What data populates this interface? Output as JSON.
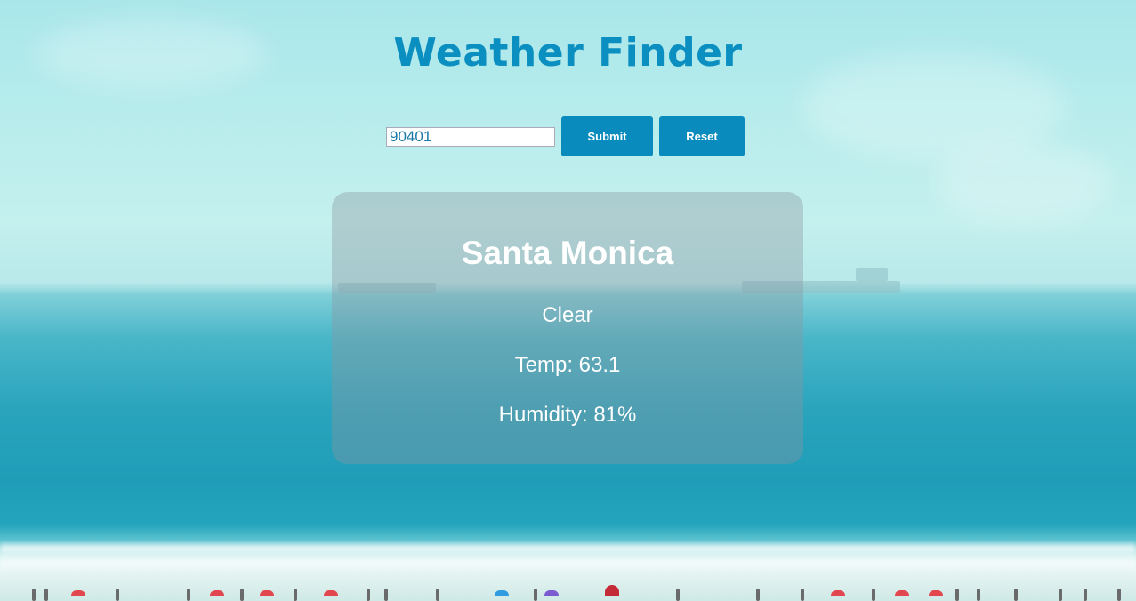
{
  "app": {
    "title": "Weather Finder"
  },
  "search": {
    "zip_value": "90401",
    "submit_label": "Submit",
    "reset_label": "Reset"
  },
  "weather": {
    "city": "Santa Monica",
    "condition": "Clear",
    "temp_text": "Temp: 63.1",
    "humidity_text": "Humidity: 81%"
  },
  "colors": {
    "accent": "#0a8bbd",
    "title": "#0a8fc0",
    "card_text": "#ffffff"
  }
}
